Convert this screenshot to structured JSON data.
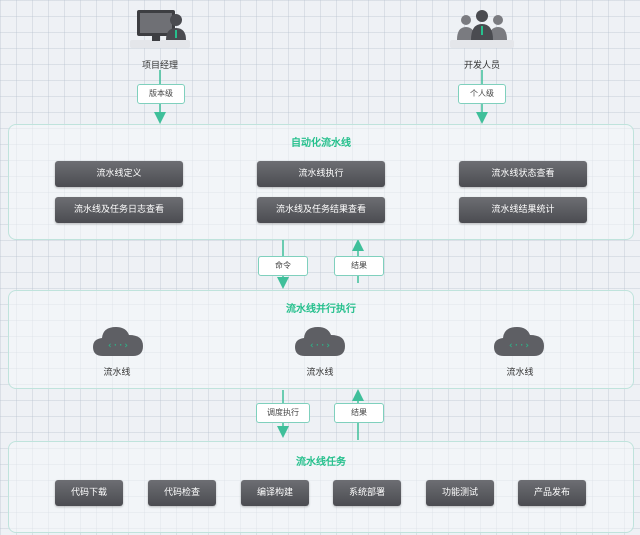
{
  "actors": {
    "pm": {
      "label": "项目经理",
      "icon": "monitor-user-icon"
    },
    "dev": {
      "label": "开发人员",
      "icon": "people-group-icon"
    }
  },
  "tags": {
    "version_level": "版本级",
    "personal_level": "个人级",
    "command": "命令",
    "result_top": "结果",
    "schedule": "调度执行",
    "result_bottom": "结果"
  },
  "automation": {
    "title": "自动化流水线",
    "buttons": [
      "流水线定义",
      "流水线执行",
      "流水线状态查看",
      "流水线及任务日志查看",
      "流水线及任务结果查看",
      "流水线结果统计"
    ]
  },
  "parallel": {
    "title": "流水线并行执行",
    "clouds": [
      "流水线",
      "流水线",
      "流水线"
    ]
  },
  "tasks": {
    "title": "流水线任务",
    "buttons": [
      "代码下载",
      "代码检查",
      "编译构建",
      "系统部署",
      "功能测试",
      "产品发布"
    ]
  },
  "colors": {
    "accent": "#26c08d",
    "button": "#55565b",
    "border": "#bfe3dc"
  }
}
